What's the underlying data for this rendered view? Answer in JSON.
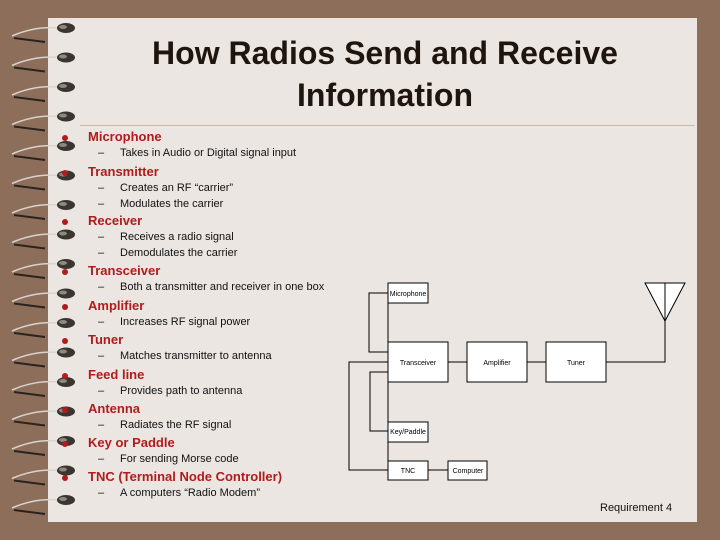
{
  "slide": {
    "title_line1": "How Radios Send and Receive",
    "title_line2": "Information",
    "footer": "Requirement 4",
    "colors": {
      "background": "#8d6e5a",
      "paper": "#ebe6e2",
      "heading": "#b01c1c",
      "title": "#1f150f"
    }
  },
  "items": [
    {
      "heading": "Microphone",
      "subs": [
        "Takes in Audio or Digital signal input"
      ]
    },
    {
      "heading": "Transmitter",
      "subs": [
        "Creates an RF “carrier”",
        "Modulates the carrier"
      ]
    },
    {
      "heading": "Receiver",
      "subs": [
        "Receives a radio signal",
        "Demodulates the carrier"
      ]
    },
    {
      "heading": "Transceiver",
      "subs": [
        "Both a transmitter and receiver in one box"
      ]
    },
    {
      "heading": "Amplifier",
      "subs": [
        "Increases RF signal power"
      ]
    },
    {
      "heading": "Tuner",
      "subs": [
        "Matches transmitter to antenna"
      ]
    },
    {
      "heading": "Feed line",
      "subs": [
        "Provides path to antenna"
      ]
    },
    {
      "heading": "Antenna",
      "subs": [
        "Radiates the RF signal"
      ]
    },
    {
      "heading": "Key or Paddle",
      "subs": [
        "For sending Morse code"
      ]
    },
    {
      "heading": "TNC (Terminal Node Controller)",
      "subs": [
        "A computers “Radio Modem”"
      ]
    }
  ],
  "dash": "–",
  "diagram": {
    "microphone": "Microphone",
    "transceiver": "Transceiver",
    "amplifier": "Amplifier",
    "tuner": "Tuner",
    "key_paddle": "Key/Paddle",
    "tnc": "TNC",
    "computer": "Computer"
  }
}
